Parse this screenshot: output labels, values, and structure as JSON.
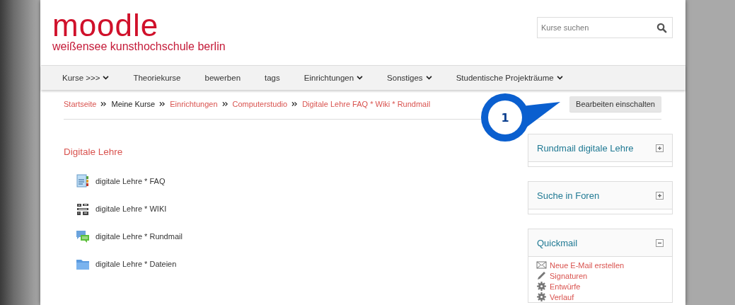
{
  "header": {
    "logo": "moodle",
    "subtitle": "weißensee kunsthochschule berlin",
    "search": {
      "placeholder": "Kurse suchen"
    }
  },
  "nav": [
    {
      "label": "Kurse >>>",
      "dropdown": true
    },
    {
      "label": "Theoriekurse",
      "dropdown": false
    },
    {
      "label": "bewerben",
      "dropdown": false
    },
    {
      "label": "tags",
      "dropdown": false
    },
    {
      "label": "Einrichtungen",
      "dropdown": true
    },
    {
      "label": "Sonstiges",
      "dropdown": true
    },
    {
      "label": "Studentische Projekträume",
      "dropdown": true
    }
  ],
  "breadcrumb": [
    {
      "label": "Startseite",
      "link": true
    },
    {
      "label": "Meine Kurse",
      "link": false
    },
    {
      "label": "Einrichtungen",
      "link": true
    },
    {
      "label": "Computerstudio",
      "link": true
    },
    {
      "label": "Digitale Lehre FAQ * Wiki * Rundmail",
      "link": true
    }
  ],
  "edit_button": "Bearbeiten einschalten",
  "callout": "1",
  "section": {
    "title": "Digitale Lehre",
    "activities": [
      {
        "kind": "glossary",
        "label": "digitale Lehre * FAQ"
      },
      {
        "kind": "wiki",
        "label": "digitale Lehre * WIKI"
      },
      {
        "kind": "forum",
        "label": "digitale Lehre * Rundmail"
      },
      {
        "kind": "folder",
        "label": "digitale Lehre * Dateien"
      }
    ]
  },
  "blocks": [
    {
      "title": "Rundmail digitale Lehre",
      "expanded": false
    },
    {
      "title": "Suche in Foren",
      "expanded": false
    },
    {
      "title": "Quickmail",
      "expanded": true,
      "items": [
        {
          "kind": "mail",
          "label": "Neue E-Mail erstellen"
        },
        {
          "kind": "pencil",
          "label": "Signaturen"
        },
        {
          "kind": "gear",
          "label": "Entwürfe"
        },
        {
          "kind": "gear",
          "label": "Verlauf"
        }
      ]
    }
  ]
}
